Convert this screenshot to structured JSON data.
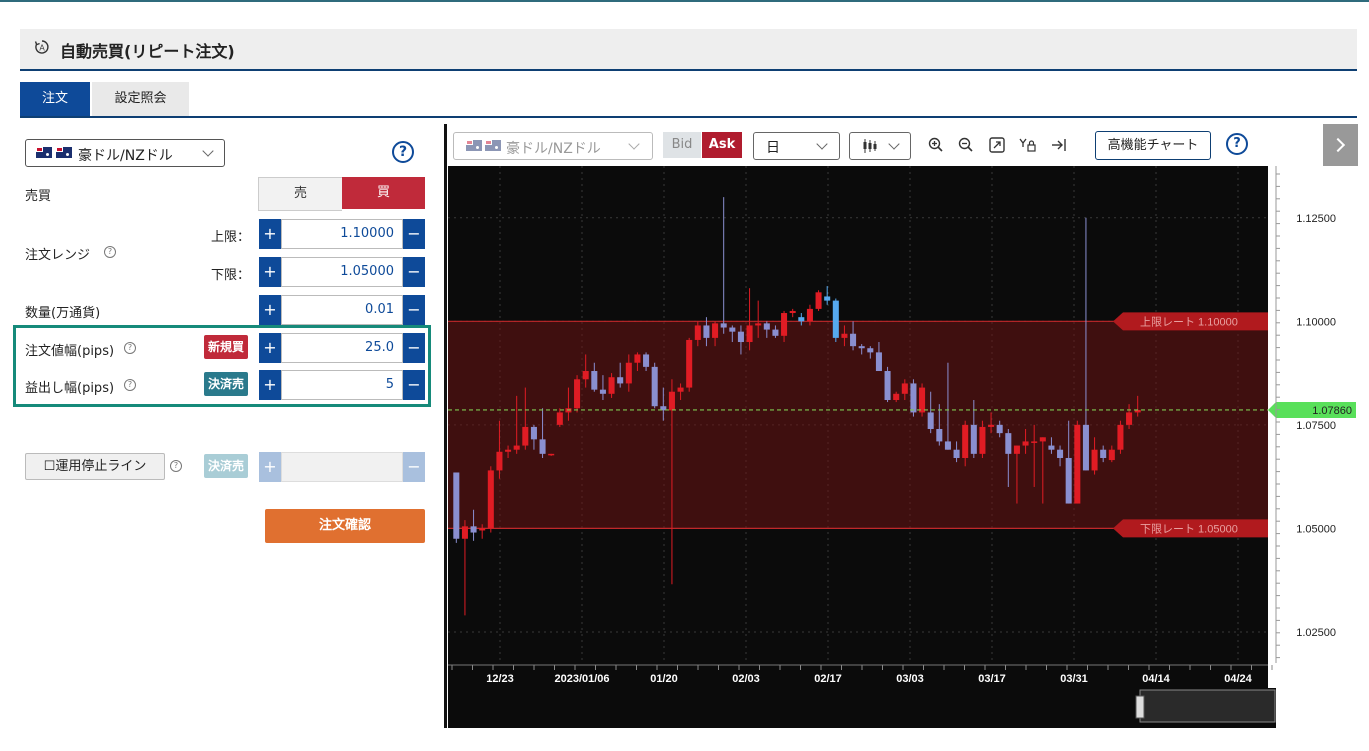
{
  "header": {
    "title": "自動売買(リピート注文)",
    "icon": "auto-trade-icon"
  },
  "tabs": [
    {
      "label": "注文",
      "active": true
    },
    {
      "label": "設定照会",
      "active": false
    }
  ],
  "form": {
    "pair": "豪ドル/NZドル",
    "side_label": "売買",
    "sell": "売",
    "buy": "買",
    "range_label": "注文レンジ",
    "upper_label": "上限：",
    "upper_value": "1.10000",
    "lower_label": "下限：",
    "lower_value": "1.05000",
    "qty_label": "数量(万通貨)",
    "qty_value": "0.01",
    "width_label": "注文値幅(pips)",
    "width_badge": "新規買",
    "width_value": "25.0",
    "profit_label": "益出し幅(pips)",
    "profit_badge": "決済売",
    "profit_value": "5",
    "stop_label": "運用停止ライン",
    "stop_badge": "決済売",
    "stop_value": "",
    "confirm": "注文確認",
    "plus": "+",
    "minus": "−"
  },
  "chart_toolbar": {
    "pair": "豪ドル/NZドル",
    "bid": "Bid",
    "ask": "Ask",
    "period": "日",
    "advanced": "高機能チャート"
  },
  "colors": {
    "accent": "#0e4a99",
    "buy": "#c02a3a",
    "profit": "#2a7a8c",
    "confirm": "#e07030",
    "highlight": "#168a7a"
  },
  "chart_data": {
    "type": "candlestick",
    "y_ticks": [
      "1.12500",
      "1.10000",
      "1.07500",
      "1.05000",
      "1.02500"
    ],
    "x_ticks": [
      "12/23",
      "2023/01/06",
      "01/20",
      "02/03",
      "02/17",
      "03/03",
      "03/17",
      "03/31",
      "04/14",
      "04/24"
    ],
    "ylim": [
      1.0175,
      1.1375
    ],
    "range": {
      "upper": 1.1,
      "lower": 1.05
    },
    "upper_label": "上限レート 1.10000",
    "lower_label": "下限レート 1.05000",
    "current_price": "1.07860",
    "candles": [
      [
        1.0635,
        1.0635,
        1.0465,
        1.0475
      ],
      [
        1.0475,
        1.052,
        1.029,
        1.0505
      ],
      [
        1.0505,
        1.0545,
        1.047,
        1.049
      ],
      [
        1.0495,
        1.051,
        1.0475,
        1.05
      ],
      [
        1.05,
        1.065,
        1.049,
        1.064
      ],
      [
        1.064,
        1.076,
        1.062,
        1.0685
      ],
      [
        1.0685,
        1.07,
        1.067,
        1.069
      ],
      [
        1.069,
        1.082,
        1.068,
        1.07
      ],
      [
        1.07,
        1.084,
        1.069,
        1.0745
      ],
      [
        1.0745,
        1.075,
        1.069,
        1.0715
      ],
      [
        1.0715,
        1.079,
        1.067,
        1.068
      ],
      [
        1.068,
        1.068,
        1.0675,
        1.068
      ],
      [
        1.075,
        1.079,
        1.0745,
        1.078
      ],
      [
        1.078,
        1.084,
        1.076,
        1.079
      ],
      [
        1.079,
        1.087,
        1.078,
        1.086
      ],
      [
        1.086,
        1.092,
        1.084,
        1.088
      ],
      [
        1.088,
        1.09,
        1.083,
        1.0835
      ],
      [
        1.0835,
        1.087,
        1.081,
        1.0825
      ],
      [
        1.0825,
        1.0875,
        1.0815,
        1.0865
      ],
      [
        1.0865,
        1.09,
        1.084,
        1.085
      ],
      [
        1.085,
        1.092,
        1.083,
        1.09
      ],
      [
        1.09,
        1.0925,
        1.088,
        1.092
      ],
      [
        1.092,
        1.0925,
        1.088,
        1.089
      ],
      [
        1.089,
        1.09,
        1.079,
        1.0795
      ],
      [
        1.0795,
        1.084,
        1.076,
        1.0785
      ],
      [
        1.0785,
        1.086,
        1.0365,
        1.083
      ],
      [
        1.083,
        1.085,
        1.081,
        1.084
      ],
      [
        1.084,
        1.096,
        1.083,
        1.0955
      ],
      [
        1.0955,
        1.1,
        1.094,
        1.099
      ],
      [
        1.099,
        1.101,
        1.094,
        1.096
      ],
      [
        1.096,
        1.1,
        1.094,
        1.0995
      ],
      [
        1.0995,
        1.13,
        1.097,
        1.0985
      ],
      [
        1.0985,
        1.099,
        1.095,
        1.0975
      ],
      [
        1.0975,
        1.099,
        1.092,
        1.095
      ],
      [
        1.095,
        1.108,
        1.093,
        1.099
      ],
      [
        1.099,
        1.105,
        1.096,
        1.0995
      ],
      [
        1.0995,
        1.1,
        1.096,
        1.098
      ],
      [
        1.098,
        1.099,
        1.096,
        1.0965
      ],
      [
        1.0965,
        1.1025,
        1.095,
        1.102
      ],
      [
        1.102,
        1.103,
        1.101,
        1.1025
      ],
      [
        1.101,
        1.102,
        1.099,
        1.1
      ],
      [
        1.1,
        1.104,
        1.099,
        1.103
      ],
      [
        1.103,
        1.1075,
        1.1025,
        1.107
      ],
      [
        1.106,
        1.1085,
        1.104,
        1.105
      ],
      [
        1.105,
        1.1055,
        1.095,
        1.096
      ],
      [
        1.096,
        1.099,
        1.094,
        1.097
      ],
      [
        1.097,
        1.1,
        1.093,
        1.094
      ],
      [
        1.094,
        1.0945,
        1.092,
        1.0935
      ],
      [
        1.0935,
        1.094,
        1.091,
        1.0925
      ],
      [
        1.0925,
        1.095,
        1.089,
        1.088
      ],
      [
        1.088,
        1.089,
        1.0805,
        1.081
      ],
      [
        1.081,
        1.083,
        1.0805,
        1.0825
      ],
      [
        1.0825,
        1.086,
        1.081,
        1.085
      ],
      [
        1.085,
        1.086,
        1.077,
        1.078
      ],
      [
        1.078,
        1.085,
        1.077,
        1.084
      ],
      [
        1.078,
        1.083,
        1.073,
        1.074
      ],
      [
        1.074,
        1.08,
        1.07,
        1.071
      ],
      [
        1.071,
        1.09,
        1.069,
        1.069
      ],
      [
        1.069,
        1.071,
        1.066,
        1.067
      ],
      [
        1.067,
        1.076,
        1.065,
        1.075
      ],
      [
        1.075,
        1.081,
        1.067,
        1.068
      ],
      [
        1.068,
        1.076,
        1.067,
        1.0745
      ],
      [
        1.0745,
        1.078,
        1.073,
        1.075
      ],
      [
        1.075,
        1.076,
        1.072,
        1.073
      ],
      [
        1.073,
        1.074,
        1.06,
        1.068
      ],
      [
        1.068,
        1.07,
        1.056,
        1.07
      ],
      [
        1.07,
        1.074,
        1.068,
        1.071
      ],
      [
        1.071,
        1.075,
        1.06,
        1.071
      ],
      [
        1.071,
        1.072,
        1.056,
        1.072
      ],
      [
        1.07,
        1.072,
        1.068,
        1.069
      ],
      [
        1.069,
        1.07,
        1.065,
        1.067
      ],
      [
        1.067,
        1.076,
        1.056,
        1.056
      ],
      [
        1.056,
        1.076,
        1.056,
        1.075
      ],
      [
        1.075,
        1.125,
        1.064,
        1.064
      ],
      [
        1.064,
        1.072,
        1.063,
        1.069
      ],
      [
        1.069,
        1.07,
        1.066,
        1.067
      ],
      [
        1.0665,
        1.07,
        1.066,
        1.069
      ],
      [
        1.069,
        1.076,
        1.068,
        1.075
      ],
      [
        1.075,
        1.08,
        1.074,
        1.078
      ],
      [
        1.078,
        1.082,
        1.077,
        1.0786
      ]
    ]
  }
}
